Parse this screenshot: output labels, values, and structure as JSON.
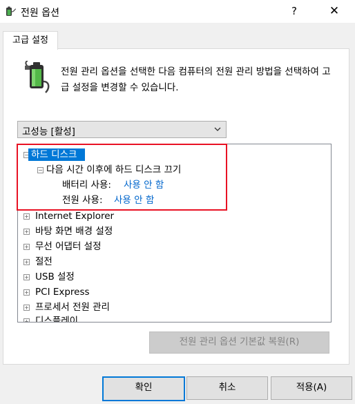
{
  "window": {
    "title": "전원 옵션",
    "help": "?",
    "close": "✕"
  },
  "tab": {
    "label": "고급 설정"
  },
  "description": "전원 관리 옵션을 선택한 다음 컴퓨터의 전원 관리 방법을 선택하여 고급 설정을 변경할 수 있습니다.",
  "plan_select": {
    "value": "고성능 [활성]"
  },
  "tree": {
    "hard_disk": {
      "label": "하드 디스크",
      "expander": "−"
    },
    "turn_off": {
      "label": "다음 시간 이후에 하드 디스크 끄기",
      "expander": "−"
    },
    "battery": {
      "label": "배터리 사용:",
      "value": "사용 안 함"
    },
    "plugged": {
      "label": "전원 사용:",
      "value": "사용 안 함"
    },
    "items": [
      {
        "label": "Internet Explorer",
        "expander": "+"
      },
      {
        "label": "바탕 화면 배경 설정",
        "expander": "+"
      },
      {
        "label": "무선 어댑터 설정",
        "expander": "+"
      },
      {
        "label": "절전",
        "expander": "+"
      },
      {
        "label": "USB 설정",
        "expander": "+"
      },
      {
        "label": "PCI Express",
        "expander": "+"
      },
      {
        "label": "프로세서 전원 관리",
        "expander": "+"
      },
      {
        "label": "디스플레이",
        "expander": "+"
      }
    ]
  },
  "buttons": {
    "restore": "전원 관리 옵션 기본값 복원(R)",
    "ok": "확인",
    "cancel": "취소",
    "apply": "적용(A)"
  },
  "colors": {
    "selection": "#0078d7",
    "highlight_box": "#e81123",
    "link_value": "#0066cc"
  }
}
